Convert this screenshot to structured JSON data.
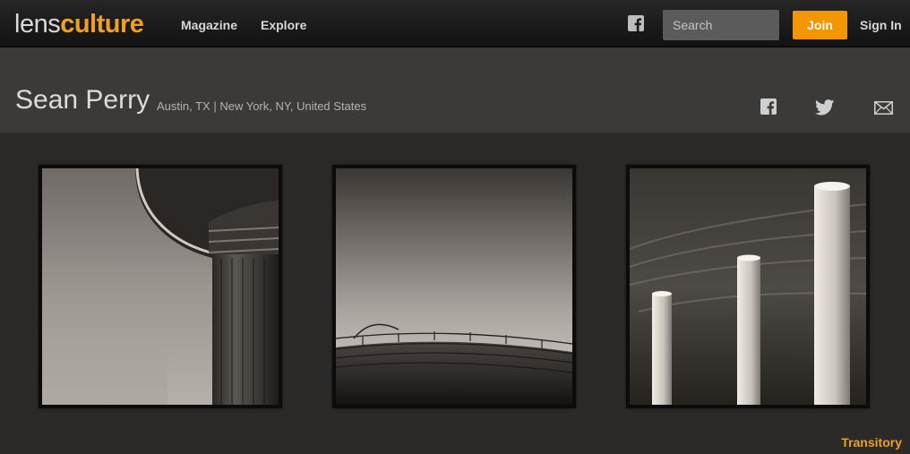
{
  "brand": {
    "logo_light": "lens",
    "logo_bold": "culture",
    "accent_color": "#f39600"
  },
  "nav": {
    "magazine_label": "Magazine",
    "explore_label": "Explore",
    "facebook_icon": "facebook-icon",
    "search_placeholder": "Search",
    "search_value": "",
    "join_label": "Join",
    "signin_label": "Sign In"
  },
  "profile": {
    "name": "Sean Perry",
    "location": "Austin, TX | New York, NY, United States",
    "share_icons": [
      "facebook-icon",
      "twitter-icon",
      "email-icon"
    ]
  },
  "gallery": {
    "photos": [
      {
        "subject": "water tower detail"
      },
      {
        "subject": "curved dome roof with railing"
      },
      {
        "subject": "three smokestacks"
      }
    ],
    "series_title": "Transitory"
  }
}
